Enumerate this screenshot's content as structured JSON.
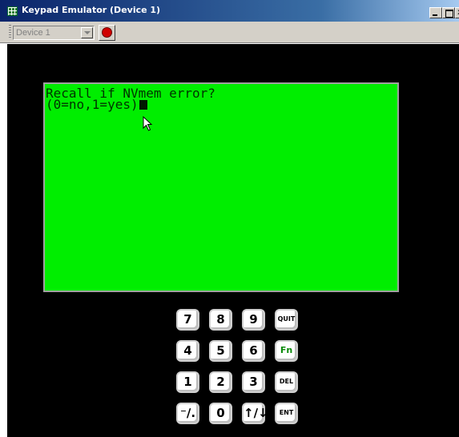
{
  "window": {
    "title": "Keypad Emulator (Device 1)",
    "minimize_glyph": "",
    "maximize_glyph": "",
    "close_glyph": "x"
  },
  "toolbar": {
    "device_value": "Device 1",
    "stop_icon": "stop-circle-icon"
  },
  "lcd": {
    "line1": "Recall if NVmem error?",
    "line2": "(0=no,1=yes)",
    "background_color": "#00ee00"
  },
  "keypad": {
    "row1": [
      "7",
      "8",
      "9",
      "QUIT"
    ],
    "row2": [
      "4",
      "5",
      "6",
      "Fn"
    ],
    "row3": [
      "1",
      "2",
      "3",
      "DEL"
    ],
    "row4": [
      "⁻∕.",
      "0",
      "↑∕↓",
      "ENT"
    ]
  }
}
